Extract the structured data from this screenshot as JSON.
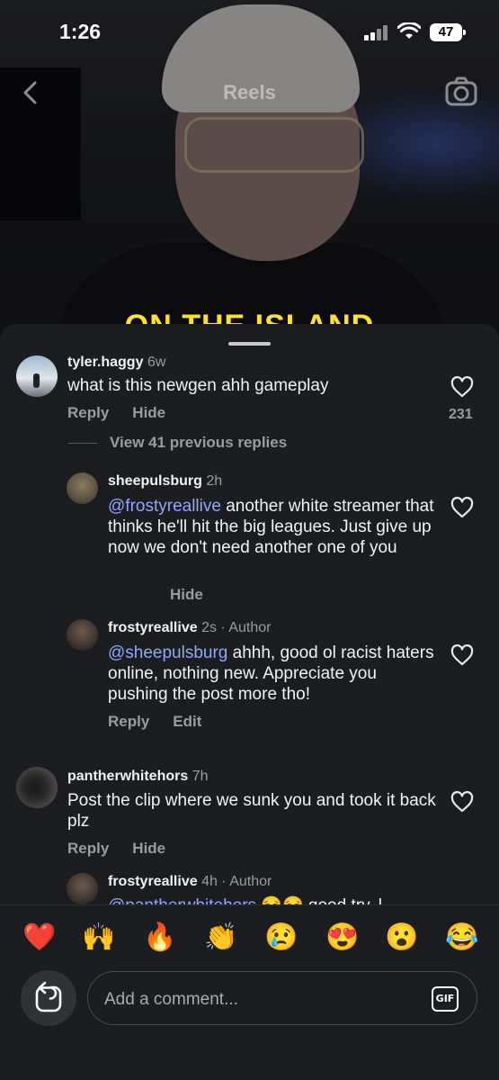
{
  "status_bar": {
    "time": "1:26",
    "battery": "47"
  },
  "header": {
    "title": "Reels"
  },
  "video": {
    "caption": "ON THE ISLAND"
  },
  "comments": [
    {
      "username": "tyler.haggy",
      "meta": "6w",
      "text": "what is this newgen ahh gameplay",
      "actions": [
        "Reply",
        "Hide"
      ],
      "likes": "231"
    },
    {
      "view_replies": "View 41 previous replies"
    },
    {
      "username": "sheepulsburg",
      "meta": "2h",
      "mention": "@frostyreallive",
      "text": " another white streamer that thinks he'll hit the big leagues. Just give up now we don't need another one of you",
      "actions": [
        "Hide"
      ]
    },
    {
      "username": "frostyreallive",
      "meta": "2s · Author",
      "mention": "@sheepulsburg",
      "text": " ahhh, good ol racist haters online, nothing new. Appreciate you pushing the post more tho!",
      "actions": [
        "Reply",
        "Edit"
      ]
    },
    {
      "username": "pantherwhitehors",
      "meta": "7h",
      "text": "Post the clip where we sunk you and took it back plz",
      "actions": [
        "Reply",
        "Hide"
      ]
    },
    {
      "username": "frostyreallive",
      "meta": "4h · Author",
      "mention": "@pantherwhitehors",
      "text": " 😒😒 good try, l"
    }
  ],
  "emoji_bar": [
    "❤️",
    "🙌",
    "🔥",
    "👏",
    "😢",
    "😍",
    "😮",
    "😂"
  ],
  "composer": {
    "placeholder": "Add a comment...",
    "gif_label": "GIF"
  },
  "icons": {
    "back": "chevron-left-icon",
    "camera": "camera-icon",
    "heart": "heart-outline-icon",
    "reply": "reply-arrow-icon",
    "gif": "gif-icon"
  }
}
